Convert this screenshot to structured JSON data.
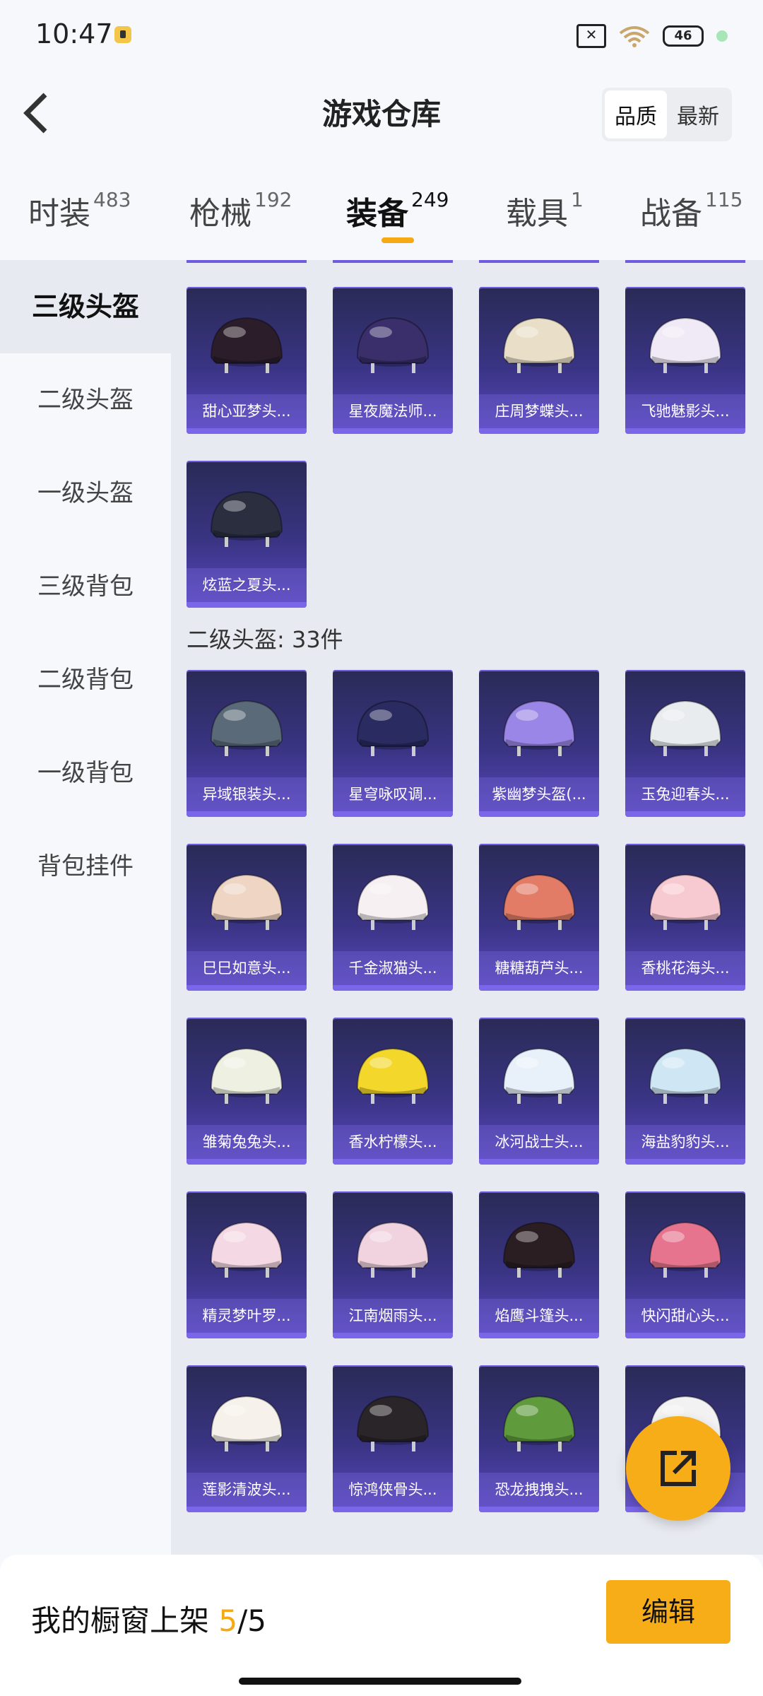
{
  "status": {
    "time": "10:47",
    "battery": "46"
  },
  "header": {
    "title": "游戏仓库",
    "sort_quality": "品质",
    "sort_latest": "最新"
  },
  "tabs": [
    {
      "label": "时装",
      "count": "483"
    },
    {
      "label": "枪械",
      "count": "192"
    },
    {
      "label": "装备",
      "count": "249"
    },
    {
      "label": "载具",
      "count": "1"
    },
    {
      "label": "战备",
      "count": "115"
    }
  ],
  "sidebar": [
    {
      "label": "三级头盔"
    },
    {
      "label": "二级头盔"
    },
    {
      "label": "一级头盔"
    },
    {
      "label": "三级背包"
    },
    {
      "label": "二级背包"
    },
    {
      "label": "一级背包"
    },
    {
      "label": "背包挂件"
    }
  ],
  "level3": {
    "items": [
      {
        "name": "甜心亚梦头...",
        "color": "#2b1e2a"
      },
      {
        "name": "星夜魔法师...",
        "color": "#3a2f6a"
      },
      {
        "name": "庄周梦蝶头...",
        "color": "#e9dfc8"
      },
      {
        "name": "飞驰魅影头...",
        "color": "#efeaf5"
      },
      {
        "name": "炫蓝之夏头...",
        "color": "#2a2e3f"
      }
    ]
  },
  "level2": {
    "title": "二级头盔: 33件",
    "items": [
      {
        "name": "异域银装头...",
        "color": "#5a6a78"
      },
      {
        "name": "星穹咏叹调...",
        "color": "#2a2b60"
      },
      {
        "name": "紫幽梦头盔(...",
        "color": "#9a86e6"
      },
      {
        "name": "玉兔迎春头...",
        "color": "#e9ecef"
      },
      {
        "name": "巳巳如意头...",
        "color": "#efd5c4"
      },
      {
        "name": "千金淑猫头...",
        "color": "#f6f0f2"
      },
      {
        "name": "糖糖葫芦头...",
        "color": "#e27c66"
      },
      {
        "name": "香桃花海头...",
        "color": "#f7c9d1"
      },
      {
        "name": "雏菊兔兔头...",
        "color": "#eef0e2"
      },
      {
        "name": "香水柠檬头...",
        "color": "#f3d72b"
      },
      {
        "name": "冰河战士头...",
        "color": "#e8f1fa"
      },
      {
        "name": "海盐豹豹头...",
        "color": "#cfe6f5"
      },
      {
        "name": "精灵梦叶罗...",
        "color": "#f4d9e4"
      },
      {
        "name": "江南烟雨头...",
        "color": "#f1d3e0"
      },
      {
        "name": "焰鹰斗篷头...",
        "color": "#2a1e22"
      },
      {
        "name": "快闪甜心头...",
        "color": "#e7748e"
      },
      {
        "name": "莲影清波头...",
        "color": "#f6f1ea"
      },
      {
        "name": "惊鸿侠骨头...",
        "color": "#2a2528"
      },
      {
        "name": "恐龙拽拽头...",
        "color": "#5f9b3c"
      },
      {
        "name": "",
        "color": "#f2f2f2"
      }
    ]
  },
  "footer": {
    "showcase_label": "我的橱窗上架",
    "showcase_count": "5",
    "showcase_total": "/5",
    "edit_label": "编辑"
  }
}
